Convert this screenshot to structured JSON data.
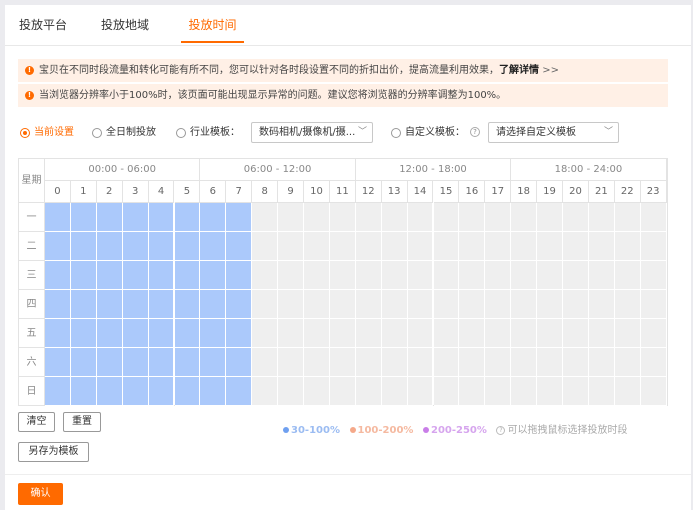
{
  "tabs": [
    "投放平台",
    "投放地域",
    "投放时间"
  ],
  "active_tab": 2,
  "notices": [
    {
      "text": "宝贝在不同时段流量和转化可能有所不同，您可以针对各时段设置不同的折扣出价，提高流量利用效果，",
      "link": "了解详情",
      "arrow": ">>"
    },
    {
      "text": "当浏览器分辨率小于100%时，该页面可能出现显示异常的问题。建议您将浏览器的分辨率调整为100%。"
    }
  ],
  "options": {
    "current": "当前设置",
    "all_day": "全日制投放",
    "industry": "行业模板：",
    "industry_value": "数码相机/摄像机/摄...",
    "custom": "自定义模板：",
    "custom_placeholder": "请选择自定义模板"
  },
  "schedule": {
    "day_header": "星期",
    "groups": [
      "00:00 - 06:00",
      "06:00 - 12:00",
      "12:00 - 18:00",
      "18:00 - 24:00"
    ],
    "hours": [
      "0",
      "1",
      "2",
      "3",
      "4",
      "5",
      "6",
      "7",
      "8",
      "9",
      "10",
      "11",
      "12",
      "13",
      "14",
      "15",
      "16",
      "17",
      "18",
      "19",
      "20",
      "21",
      "22",
      "23"
    ],
    "days": [
      "一",
      "二",
      "三",
      "四",
      "五",
      "六",
      "日"
    ],
    "selected_hours_per_day": [
      0,
      1,
      2,
      3,
      4,
      5,
      6,
      7
    ]
  },
  "buttons": {
    "clear": "清空",
    "reset": "重置",
    "save_template": "另存为模板",
    "confirm": "确认"
  },
  "legend": [
    {
      "label": "30-100%",
      "color": "#6fa0f0"
    },
    {
      "label": "100-200%",
      "color": "#f5a98a"
    },
    {
      "label": "200-250%",
      "color": "#c97ee8"
    }
  ],
  "legend_hint": "可以拖拽鼠标选择投放时段",
  "colors": {
    "accent": "#ff6a00",
    "selected_cell": "#abc9fb",
    "empty_cell": "#efefef"
  }
}
